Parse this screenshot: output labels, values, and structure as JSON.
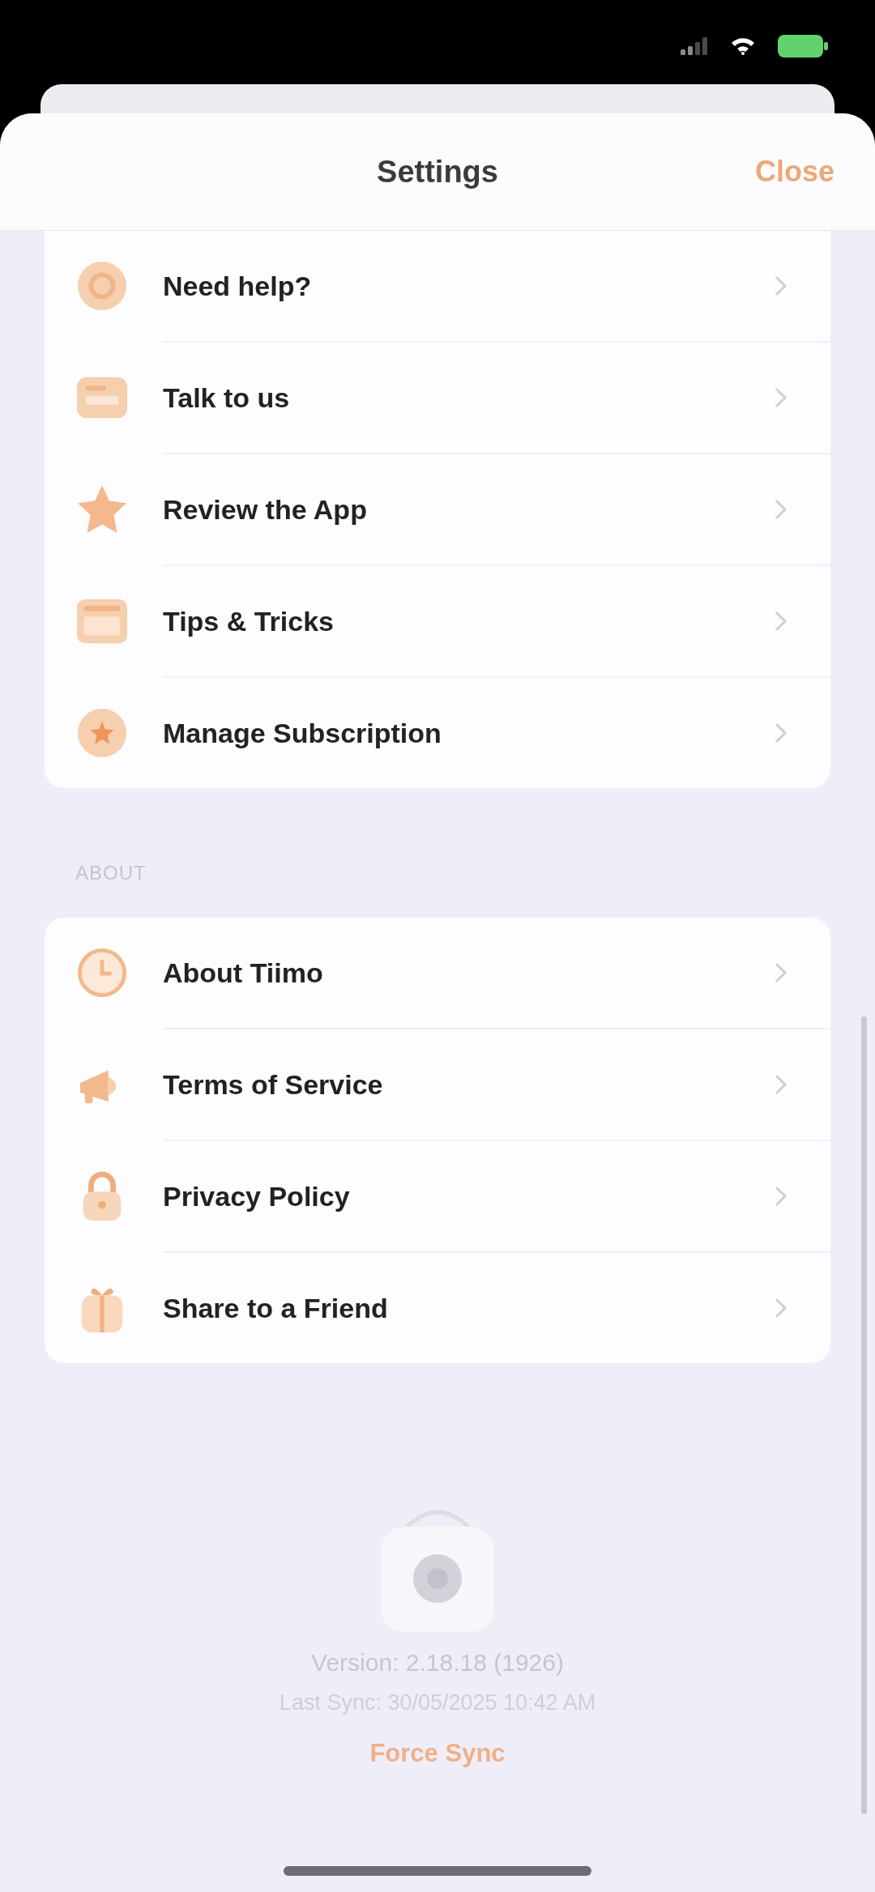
{
  "header": {
    "title": "Settings",
    "close_label": "Close"
  },
  "sections": [
    {
      "items": [
        {
          "label": "Need help?"
        },
        {
          "label": "Talk to us"
        },
        {
          "label": "Review the App"
        },
        {
          "label": "Tips & Tricks"
        },
        {
          "label": "Manage Subscription"
        }
      ]
    },
    {
      "heading": "ABOUT",
      "items": [
        {
          "label": "About Tiimo"
        },
        {
          "label": "Terms of Service"
        },
        {
          "label": "Privacy Policy"
        },
        {
          "label": "Share to a Friend"
        }
      ]
    }
  ],
  "footer": {
    "version": "Version: 2.18.18 (1926)",
    "last_sync": "Last Sync: 30/05/2025 10:42 AM",
    "force_sync_label": "Force Sync"
  }
}
